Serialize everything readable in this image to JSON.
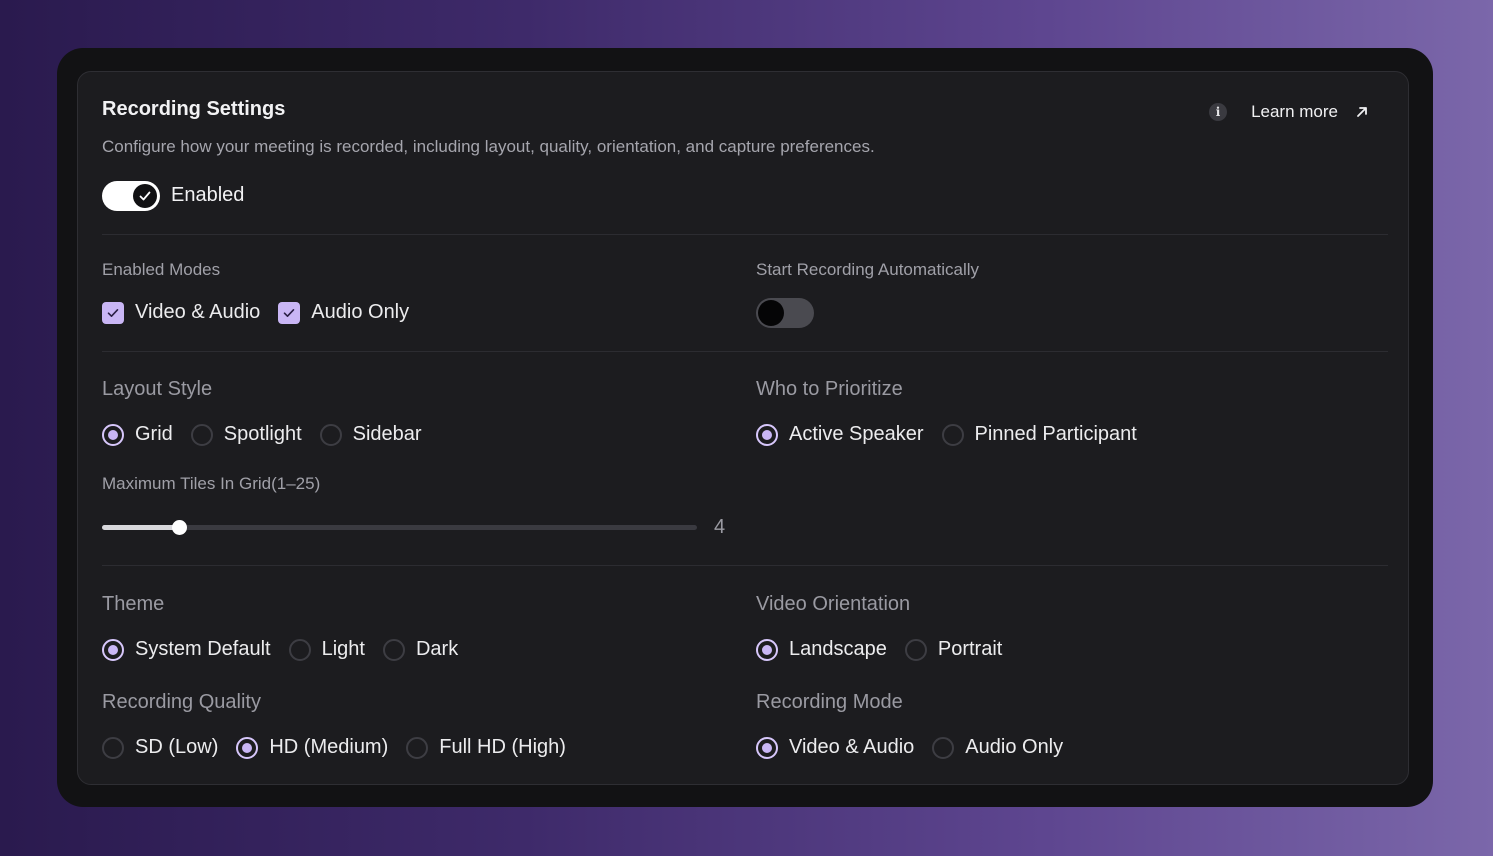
{
  "header": {
    "title": "Recording Settings",
    "description": "Configure how your meeting is recorded, including layout, quality, orientation, and capture preferences.",
    "learn_more": "Learn more",
    "info_icon": "i"
  },
  "recording_toggle": {
    "label": "Enabled",
    "on": true
  },
  "enabled_modes": {
    "label": "Enabled Modes",
    "options": [
      {
        "label": "Video & Audio",
        "checked": true
      },
      {
        "label": "Audio Only",
        "checked": true
      }
    ]
  },
  "auto_start": {
    "label": "Start Recording Automatically",
    "on": false
  },
  "layout_style": {
    "label": "Layout Style",
    "options": [
      "Grid",
      "Spotlight",
      "Sidebar"
    ],
    "selected": "Grid"
  },
  "prioritize": {
    "label": "Who to Prioritize",
    "options": [
      "Active Speaker",
      "Pinned Participant"
    ],
    "selected": "Active Speaker"
  },
  "max_tiles": {
    "label": "Maximum Tiles In Grid(1–25)",
    "value": "4",
    "min": 1,
    "max": 25,
    "fill_fraction": 0.13
  },
  "theme": {
    "label": "Theme",
    "options": [
      "System Default",
      "Light",
      "Dark"
    ],
    "selected": "System Default"
  },
  "orientation": {
    "label": "Video Orientation",
    "options": [
      "Landscape",
      "Portrait"
    ],
    "selected": "Landscape"
  },
  "quality": {
    "label": "Recording Quality",
    "options": [
      "SD (Low)",
      "HD (Medium)",
      "Full HD (High)"
    ],
    "selected": "HD (Medium)"
  },
  "recording_mode": {
    "label": "Recording Mode",
    "options": [
      "Video & Audio",
      "Audio Only"
    ],
    "selected": "Video & Audio"
  },
  "colors": {
    "accent": "#c9b6f5",
    "card": "#1c1c1f",
    "frame": "#121214"
  }
}
